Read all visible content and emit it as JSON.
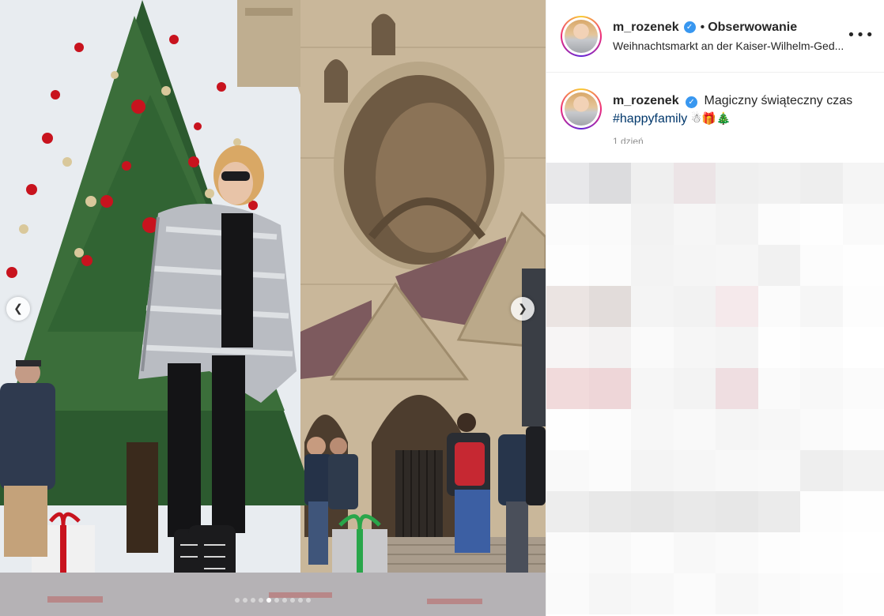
{
  "post": {
    "username": "m_rozenek",
    "separator": "•",
    "follow_label": "Obserwowanie",
    "location": "Weihnachtsmarkt an der Kaiser-Wilhelm-Ged...",
    "more_icon": "more-options-icon",
    "verified_icon": "verified-badge-icon"
  },
  "caption": {
    "username": "m_rozenek",
    "text": "Magiczny świąteczny czas",
    "hashtag": "#happyfamily",
    "emojis": "☃🎁🎄",
    "timestamp": "1 dzień"
  },
  "carousel": {
    "prev_icon": "chevron-left-icon",
    "next_icon": "chevron-right-icon",
    "total_slides": 10,
    "active_slide": 5
  },
  "colors": {
    "link": "#00376b",
    "verified": "#3897f0",
    "text": "#262626",
    "muted": "#8e8e8e"
  }
}
